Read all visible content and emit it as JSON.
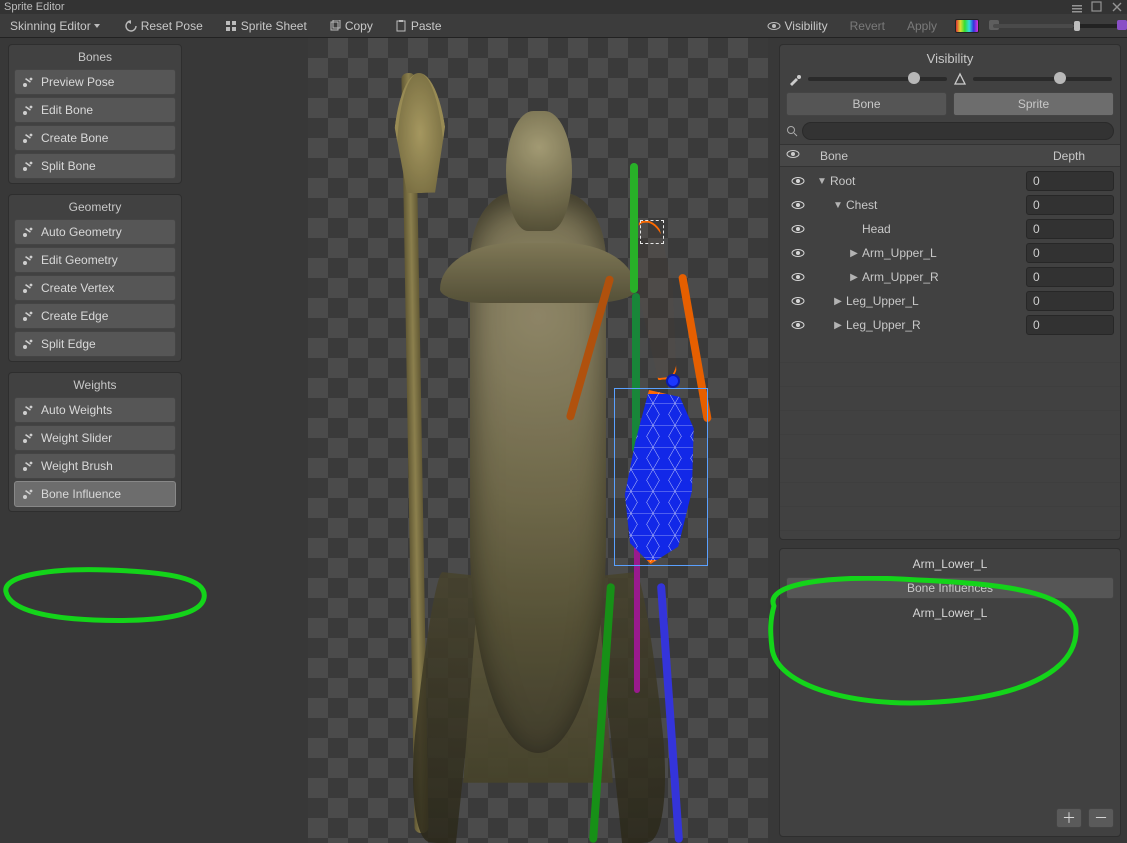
{
  "titlebar": {
    "title": "Sprite Editor"
  },
  "toolbar": {
    "mode": "Skinning Editor",
    "reset_pose": "Reset Pose",
    "sprite_sheet": "Sprite Sheet",
    "copy": "Copy",
    "paste": "Paste",
    "visibility": "Visibility",
    "revert": "Revert",
    "apply": "Apply"
  },
  "panels": {
    "bones": {
      "title": "Bones",
      "buttons": [
        "Preview Pose",
        "Edit Bone",
        "Create Bone",
        "Split Bone"
      ]
    },
    "geometry": {
      "title": "Geometry",
      "buttons": [
        "Auto Geometry",
        "Edit Geometry",
        "Create Vertex",
        "Create Edge",
        "Split Edge"
      ]
    },
    "weights": {
      "title": "Weights",
      "buttons": [
        "Auto Weights",
        "Weight Slider",
        "Weight Brush",
        "Bone Influence"
      ],
      "selected_index": 3
    }
  },
  "visibility_panel": {
    "title": "Visibility",
    "tabs": {
      "bone": "Bone",
      "sprite": "Sprite",
      "active": "sprite"
    },
    "search_placeholder": "",
    "columns": {
      "bone": "Bone",
      "depth": "Depth"
    },
    "slider_left_pos": 0.72,
    "slider_right_pos": 0.58,
    "tree": [
      {
        "label": "Root",
        "indent": 0,
        "depth": "0",
        "expander": "▼"
      },
      {
        "label": "Chest",
        "indent": 1,
        "depth": "0",
        "expander": "▼"
      },
      {
        "label": "Head",
        "indent": 2,
        "depth": "0",
        "expander": ""
      },
      {
        "label": "Arm_Upper_L",
        "indent": 2,
        "depth": "0",
        "expander": "▶"
      },
      {
        "label": "Arm_Upper_R",
        "indent": 2,
        "depth": "0",
        "expander": "▶"
      },
      {
        "label": "Leg_Upper_L",
        "indent": 1,
        "depth": "0",
        "expander": "▶"
      },
      {
        "label": "Leg_Upper_R",
        "indent": 1,
        "depth": "0",
        "expander": "▶"
      }
    ]
  },
  "influence_panel": {
    "selected_sprite": "Arm_Lower_L",
    "section": "Bone Influences",
    "items": [
      "Arm_Lower_L"
    ]
  }
}
